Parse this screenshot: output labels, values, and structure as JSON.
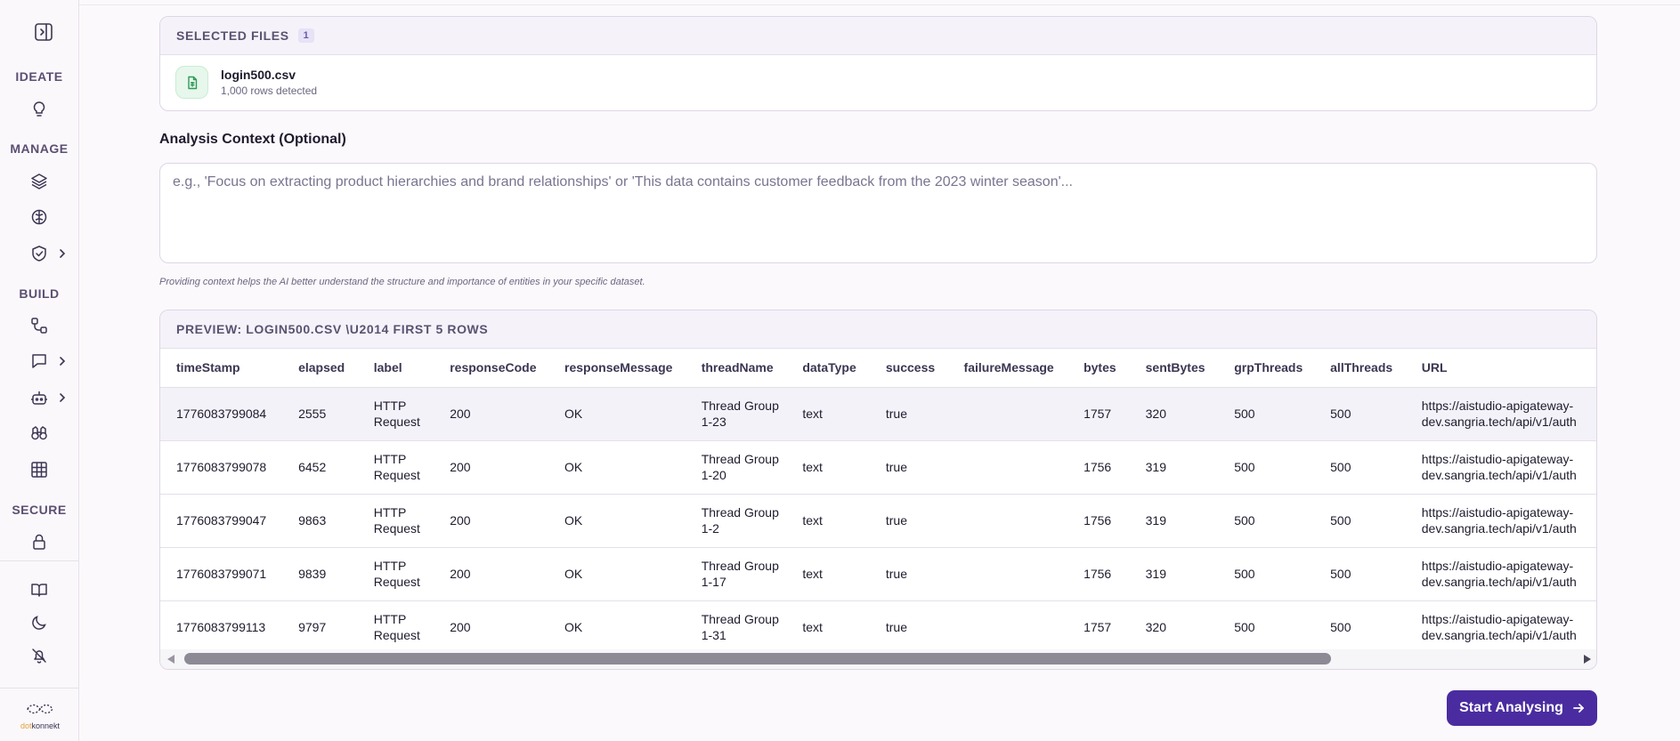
{
  "sidebar": {
    "sections": {
      "ideate": "IDEATE",
      "manage": "MANAGE",
      "build": "BUILD",
      "secure": "SECURE"
    },
    "icons": [
      "panel-toggle-icon",
      "lightbulb-icon",
      "layers-icon",
      "brain-icon",
      "shield-check-icon",
      "workflow-icon",
      "chat-icon",
      "robot-icon",
      "binoculars-icon",
      "table-grid-icon",
      "lock-icon",
      "book-icon",
      "moon-icon",
      "no-bell-icon"
    ],
    "logo": {
      "accent": "dot",
      "rest": "konnekt"
    }
  },
  "selected_files": {
    "title": "SELECTED FILES",
    "count": "1",
    "file_name": "login500.csv",
    "file_rows": "1,000 rows detected"
  },
  "context": {
    "label": "Analysis Context (Optional)",
    "placeholder": "e.g., 'Focus on extracting product hierarchies and brand relationships' or 'This data contains customer feedback from the 2023 winter season'...",
    "help": "Providing context helps the AI better understand the structure and importance of entities in your specific dataset."
  },
  "preview": {
    "title": "PREVIEW: LOGIN500.CSV \\U2014 FIRST 5 ROWS",
    "columns": [
      "timeStamp",
      "elapsed",
      "label",
      "responseCode",
      "responseMessage",
      "threadName",
      "dataType",
      "success",
      "failureMessage",
      "bytes",
      "sentBytes",
      "grpThreads",
      "allThreads",
      "URL"
    ],
    "rows": [
      [
        "1776083799084",
        "2555",
        "HTTP Request",
        "200",
        "OK",
        "Thread Group 1-23",
        "text",
        "true",
        "",
        "1757",
        "320",
        "500",
        "500",
        "https://aistudio-apigateway-dev.sangria.tech/api/v1/auth"
      ],
      [
        "1776083799078",
        "6452",
        "HTTP Request",
        "200",
        "OK",
        "Thread Group 1-20",
        "text",
        "true",
        "",
        "1756",
        "319",
        "500",
        "500",
        "https://aistudio-apigateway-dev.sangria.tech/api/v1/auth"
      ],
      [
        "1776083799047",
        "9863",
        "HTTP Request",
        "200",
        "OK",
        "Thread Group 1-2",
        "text",
        "true",
        "",
        "1756",
        "319",
        "500",
        "500",
        "https://aistudio-apigateway-dev.sangria.tech/api/v1/auth"
      ],
      [
        "1776083799071",
        "9839",
        "HTTP Request",
        "200",
        "OK",
        "Thread Group 1-17",
        "text",
        "true",
        "",
        "1756",
        "319",
        "500",
        "500",
        "https://aistudio-apigateway-dev.sangria.tech/api/v1/auth"
      ],
      [
        "1776083799113",
        "9797",
        "HTTP Request",
        "200",
        "OK",
        "Thread Group 1-31",
        "text",
        "true",
        "",
        "1757",
        "320",
        "500",
        "500",
        "https://aistudio-apigateway-dev.sangria.tech/api/v1/auth"
      ]
    ]
  },
  "actions": {
    "start_label": "Start Analysing"
  },
  "colors": {
    "accent": "#4a2ca0",
    "file_icon_green": "#2f9a58"
  }
}
